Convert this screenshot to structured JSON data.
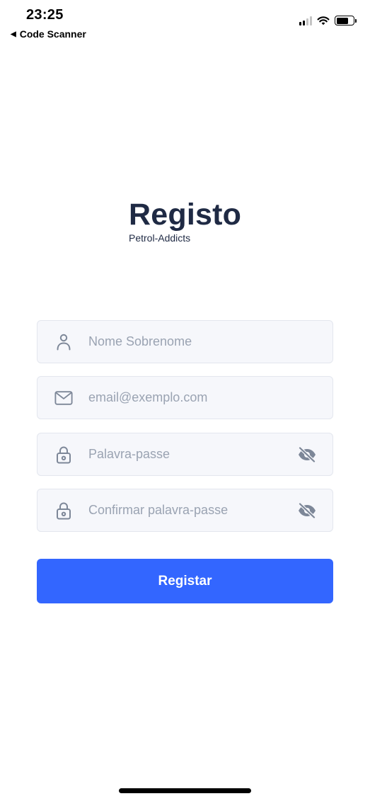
{
  "status_bar": {
    "time": "23:25",
    "back_label": "Code Scanner"
  },
  "header": {
    "title": "Registo",
    "subtitle": "Petrol-Addicts"
  },
  "form": {
    "name_placeholder": "Nome Sobrenome",
    "email_placeholder": "email@exemplo.com",
    "password_placeholder": "Palavra-passe",
    "confirm_password_placeholder": "Confirmar palavra-passe",
    "submit_label": "Registar"
  },
  "colors": {
    "primary": "#3366ff",
    "heading": "#1f2a44",
    "field_bg": "#f6f7fb",
    "placeholder": "#9aa3b2",
    "icon": "#7d8798"
  },
  "icons": {
    "name": "user-icon",
    "email": "mail-icon",
    "password": "lock-icon",
    "visibility": "eye-off-icon"
  }
}
